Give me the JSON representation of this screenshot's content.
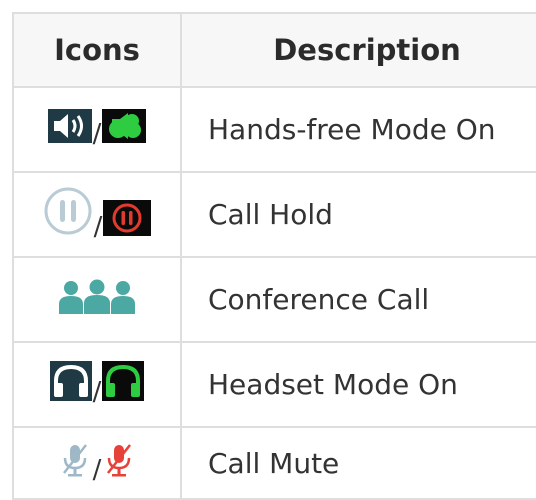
{
  "table": {
    "headers": {
      "icons": "Icons",
      "description": "Description"
    },
    "separator": "/",
    "rows": [
      {
        "icons": [
          "speaker-icon",
          "handsfree-on-icon"
        ],
        "description": "Hands-free Mode On"
      },
      {
        "icons": [
          "hold-icon",
          "hold-active-icon"
        ],
        "description": "Call Hold"
      },
      {
        "icons": [
          "conference-icon"
        ],
        "description": "Conference Call"
      },
      {
        "icons": [
          "headset-icon",
          "headset-active-icon"
        ],
        "description": "Headset Mode On"
      },
      {
        "icons": [
          "mic-muted-icon",
          "mic-muted-active-icon"
        ],
        "description": "Call Mute"
      }
    ]
  },
  "colors": {
    "border": "#dedede",
    "header_bg": "#f7f7f7",
    "dark_tile": "#1f3a44",
    "active_green": "#2ecc40",
    "hold_red": "#e23b2e",
    "conference_teal": "#4ca8a3",
    "mute_red": "#e6423a",
    "mute_gray": "#9fb8c8"
  }
}
